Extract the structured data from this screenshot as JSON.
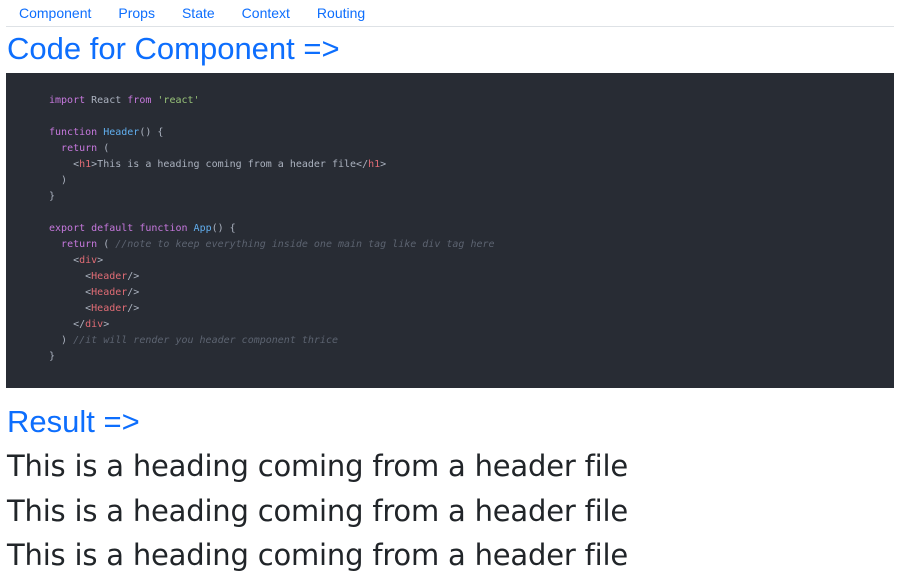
{
  "nav": {
    "items": [
      {
        "label": "Component"
      },
      {
        "label": "Props"
      },
      {
        "label": "State"
      },
      {
        "label": "Context"
      },
      {
        "label": "Routing"
      }
    ]
  },
  "component_heading": "Code for Component =>",
  "code": {
    "lines": [
      [
        {
          "t": "kw",
          "v": "import"
        },
        {
          "t": "pl",
          "v": " React "
        },
        {
          "t": "kw",
          "v": "from"
        },
        {
          "t": "pl",
          "v": " "
        },
        {
          "t": "str",
          "v": "'react'"
        }
      ],
      [],
      [
        {
          "t": "kw",
          "v": "function"
        },
        {
          "t": "pl",
          "v": " "
        },
        {
          "t": "fn",
          "v": "Header"
        },
        {
          "t": "pl",
          "v": "() {"
        }
      ],
      [
        {
          "t": "pl",
          "v": "  "
        },
        {
          "t": "kw",
          "v": "return"
        },
        {
          "t": "pl",
          "v": " ("
        }
      ],
      [
        {
          "t": "pl",
          "v": "    <"
        },
        {
          "t": "tag",
          "v": "h1"
        },
        {
          "t": "pl",
          "v": ">This is a heading coming from a header file</"
        },
        {
          "t": "tag",
          "v": "h1"
        },
        {
          "t": "pl",
          "v": ">"
        }
      ],
      [
        {
          "t": "pl",
          "v": "  )"
        }
      ],
      [
        {
          "t": "pl",
          "v": "}"
        }
      ],
      [],
      [
        {
          "t": "kw",
          "v": "export"
        },
        {
          "t": "pl",
          "v": " "
        },
        {
          "t": "kw",
          "v": "default"
        },
        {
          "t": "pl",
          "v": " "
        },
        {
          "t": "kw",
          "v": "function"
        },
        {
          "t": "pl",
          "v": " "
        },
        {
          "t": "fn",
          "v": "App"
        },
        {
          "t": "pl",
          "v": "() {"
        }
      ],
      [
        {
          "t": "pl",
          "v": "  "
        },
        {
          "t": "kw",
          "v": "return"
        },
        {
          "t": "pl",
          "v": " ( "
        },
        {
          "t": "cm",
          "v": "//note to keep everything inside one main tag like div tag here"
        }
      ],
      [
        {
          "t": "pl",
          "v": "    <"
        },
        {
          "t": "tag",
          "v": "div"
        },
        {
          "t": "pl",
          "v": ">"
        }
      ],
      [
        {
          "t": "pl",
          "v": "      <"
        },
        {
          "t": "tag",
          "v": "Header"
        },
        {
          "t": "pl",
          "v": "/>"
        }
      ],
      [
        {
          "t": "pl",
          "v": "      <"
        },
        {
          "t": "tag",
          "v": "Header"
        },
        {
          "t": "pl",
          "v": "/>"
        }
      ],
      [
        {
          "t": "pl",
          "v": "      <"
        },
        {
          "t": "tag",
          "v": "Header"
        },
        {
          "t": "pl",
          "v": "/>"
        }
      ],
      [
        {
          "t": "pl",
          "v": "    </"
        },
        {
          "t": "tag",
          "v": "div"
        },
        {
          "t": "pl",
          "v": ">"
        }
      ],
      [
        {
          "t": "pl",
          "v": "  ) "
        },
        {
          "t": "cm",
          "v": "//it will render you header component thrice"
        }
      ],
      [
        {
          "t": "pl",
          "v": "}"
        }
      ]
    ]
  },
  "result_heading": "Result =>",
  "rendered_headings": [
    "This is a heading coming from a header file",
    "This is a heading coming from a header file",
    "This is a heading coming from a header file"
  ],
  "colors": {
    "link": "#0d6efd",
    "code_bg": "#282c34",
    "keyword": "#c678dd",
    "string": "#98c379",
    "function": "#61aeee",
    "tag": "#e06c75",
    "comment": "#5c6370",
    "plain": "#abb2bf"
  }
}
